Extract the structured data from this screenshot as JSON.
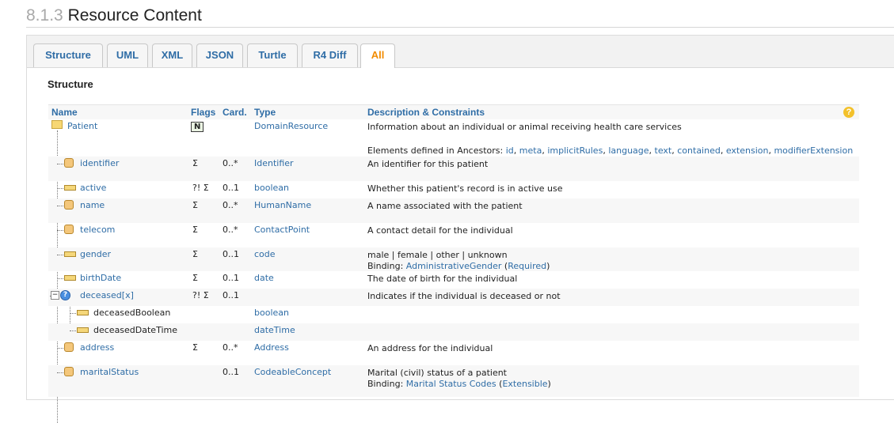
{
  "heading": {
    "number": "8.1.3",
    "title": "Resource Content"
  },
  "tabs": [
    {
      "label": "Structure"
    },
    {
      "label": "UML"
    },
    {
      "label": "XML"
    },
    {
      "label": "JSON"
    },
    {
      "label": "Turtle"
    },
    {
      "label": "R4 Diff"
    },
    {
      "label": "All",
      "active": true
    }
  ],
  "section_title": "Structure",
  "columns": {
    "name": "Name",
    "flags": "Flags",
    "card": "Card.",
    "type": "Type",
    "desc": "Description & Constraints",
    "help": "?"
  },
  "patient": {
    "name": "Patient",
    "flag": "N",
    "type": "DomainResource",
    "desc": "Information about an individual or animal receiving health care services",
    "ancestors_label": "Elements defined in Ancestors:",
    "ancestors": [
      "id",
      "meta",
      "implicitRules",
      "language",
      "text",
      "contained",
      "extension",
      "modifierExtension"
    ]
  },
  "rows": [
    {
      "name": "identifier",
      "flags": "Σ",
      "card": "0..*",
      "type": "Identifier",
      "desc": "An identifier for this patient"
    },
    {
      "name": "active",
      "flags": "?! Σ",
      "card": "0..1",
      "type": "boolean",
      "desc": "Whether this patient's record is in active use"
    },
    {
      "name": "name",
      "flags": "Σ",
      "card": "0..*",
      "type": "HumanName",
      "desc": "A name associated with the patient"
    },
    {
      "name": "telecom",
      "flags": "Σ",
      "card": "0..*",
      "type": "ContactPoint",
      "desc": "A contact detail for the individual"
    },
    {
      "name": "gender",
      "flags": "Σ",
      "card": "0..1",
      "type": "code",
      "desc": "male | female | other | unknown",
      "binding_label": "Binding:",
      "binding": "AdministrativeGender",
      "strength": "Required"
    },
    {
      "name": "birthDate",
      "flags": "Σ",
      "card": "0..1",
      "type": "date",
      "desc": "The date of birth for the individual"
    },
    {
      "name": "deceased[x]",
      "flags": "?! Σ",
      "card": "0..1",
      "type": "",
      "desc": "Indicates if the individual is deceased or not"
    },
    {
      "name": "deceasedBoolean",
      "flags": "",
      "card": "",
      "type": "boolean",
      "desc": ""
    },
    {
      "name": "deceasedDateTime",
      "flags": "",
      "card": "",
      "type": "dateTime",
      "desc": ""
    },
    {
      "name": "address",
      "flags": "Σ",
      "card": "0..*",
      "type": "Address",
      "desc": "An address for the individual"
    },
    {
      "name": "maritalStatus",
      "flags": "",
      "card": "0..1",
      "type": "CodeableConcept",
      "desc": "Marital (civil) status of a patient",
      "binding_label": "Binding:",
      "binding": "Marital Status Codes",
      "strength": "Extensible"
    }
  ]
}
